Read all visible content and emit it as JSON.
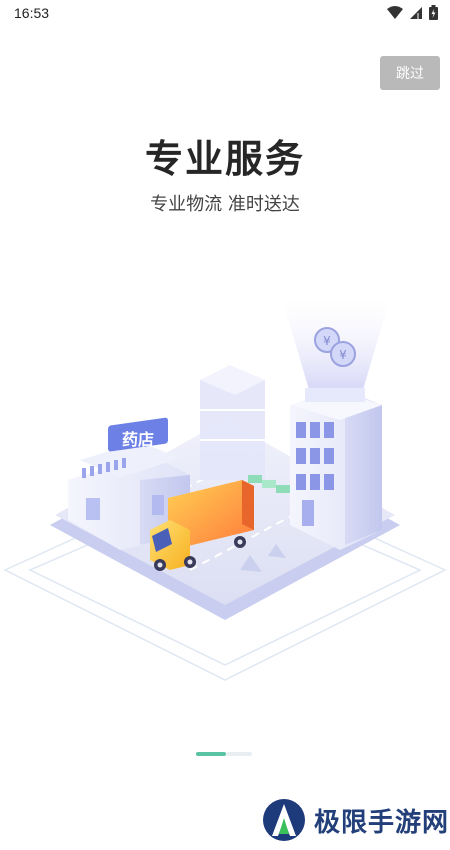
{
  "status_bar": {
    "time": "16:53",
    "icons": [
      "wifi-icon",
      "signal-icon",
      "battery-icon"
    ]
  },
  "skip_button": {
    "label": "跳过"
  },
  "onboarding": {
    "title": "专业服务",
    "subtitle": "专业物流 准时送达",
    "store_sign": "药店",
    "page_indicator": {
      "current": 1,
      "total": 2
    }
  },
  "watermark": {
    "text": "极限手游网"
  },
  "colors": {
    "skip_bg": "#b9b9b9",
    "indicator_active": "#59c3a3",
    "indicator_inactive": "#e9eef3",
    "truck_body": "#f6a623",
    "watermark": "#233f7a"
  }
}
